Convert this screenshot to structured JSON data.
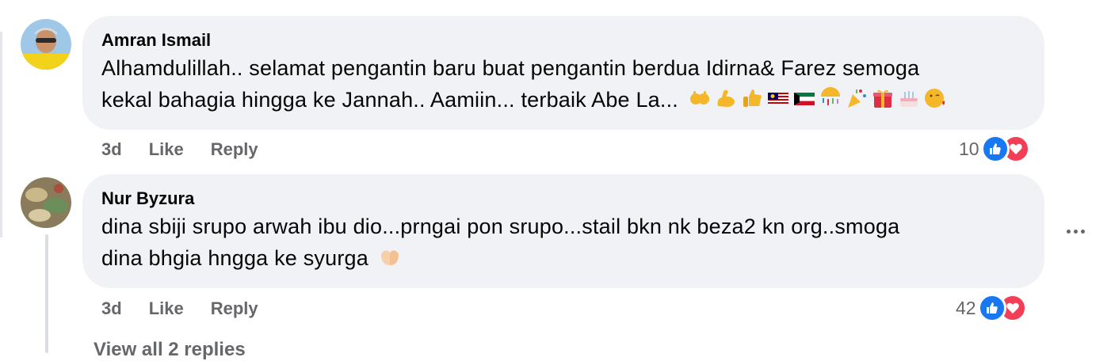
{
  "comments": [
    {
      "author": "Amran Ismail",
      "text": "Alhamdulillah.. selamat pengantin baru buat pengantin berdua Idirna& Farez semoga",
      "text_line2": "kekal bahagia hingga ke Jannah.. Aamiin... terbaik Abe La...",
      "emojis": [
        "raising-hands-icon",
        "flexed-biceps-icon",
        "thumbs-up-icon",
        "malaysia-flag-icon",
        "kuwait-flag-icon",
        "confetti-ball-icon",
        "party-popper-icon",
        "wrapped-gift-icon",
        "birthday-cake-icon",
        "face-blowing-kiss-icon"
      ],
      "time": "3d",
      "like_label": "Like",
      "reply_label": "Reply",
      "reaction_count": "10"
    },
    {
      "author": "Nur Byzura",
      "text": "dina sbiji srupo arwah ibu dio...prngai pon srupo...stail bkn nk beza2 kn org..smoga",
      "text_line2": "dina bhgia hngga ke syurga",
      "emojis": [
        "palms-up-together-icon"
      ],
      "time": "3d",
      "like_label": "Like",
      "reply_label": "Reply",
      "reaction_count": "42"
    }
  ],
  "view_replies": "View all 2 replies",
  "colors": {
    "bubble": "#f0f2f5",
    "meta": "#65676b",
    "like": "#1877f2",
    "love": "#f33e58"
  }
}
